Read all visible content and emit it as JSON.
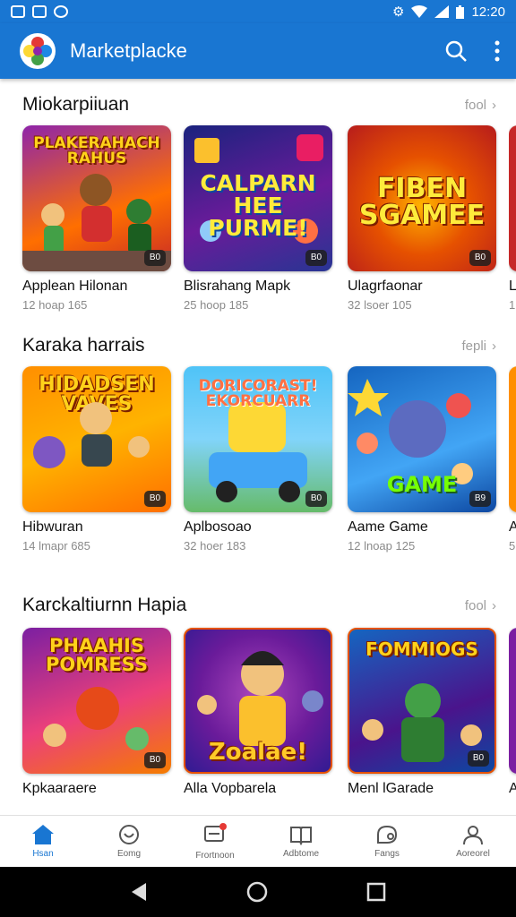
{
  "status_bar": {
    "time": "12:20"
  },
  "app_bar": {
    "title": "Marketplacke"
  },
  "sections": [
    {
      "title": "Miokarpiiuan",
      "more": "fool",
      "cards": [
        {
          "art": "PLAKERAHACH RAHUS",
          "title": "Applean Hilonan",
          "sub": "12 hoap 165",
          "badge": "B0"
        },
        {
          "art": "CALPARN HEE PURME!",
          "title": "Blisrahang Mapk",
          "sub": "25 hoop 185",
          "badge": "B0"
        },
        {
          "art": "FIBEN SGAMEE",
          "title": "Ulagrfaonar",
          "sub": "32 lsoer 105",
          "badge": "B0"
        },
        {
          "title": "L",
          "sub": "1"
        }
      ]
    },
    {
      "title": "Karaka harrais",
      "more": "fepli",
      "cards": [
        {
          "art": "HIDADSEN VAVES",
          "title": "Hibwuran",
          "sub": "14 lmapr 685",
          "badge": "B0"
        },
        {
          "art": "DORICORAST! EKORCUARR",
          "title": "Aplbosoao",
          "sub": "32 hoer 183",
          "badge": "B0"
        },
        {
          "art": "GAME",
          "title": "Aame Game",
          "sub": "12 lnoap 125",
          "badge": "B9"
        },
        {
          "title": "A",
          "sub": "5"
        }
      ]
    },
    {
      "title": "Karckaltiurnn Hapia",
      "more": "fool",
      "cards": [
        {
          "art": "PHAAHIS POMRESS",
          "title": "Kpkaaraere",
          "sub": "",
          "badge": "B0"
        },
        {
          "art": "Zoalae!",
          "title": "Alla Vopbarela",
          "sub": "",
          "badge": ""
        },
        {
          "art": "FOMMIOGS",
          "title": "Menl lGarade",
          "sub": "",
          "badge": "B0"
        },
        {
          "title": "A",
          "sub": ""
        }
      ]
    }
  ],
  "bottom_nav": [
    {
      "label": "Hsan",
      "icon": "home-icon",
      "active": true
    },
    {
      "label": "Eomg",
      "icon": "heart-icon"
    },
    {
      "label": "Frortnoon",
      "icon": "message-icon"
    },
    {
      "label": "Adbtome",
      "icon": "book-icon"
    },
    {
      "label": "Fangs",
      "icon": "tag-icon"
    },
    {
      "label": "Aoreorel",
      "icon": "person-icon"
    }
  ],
  "colors": {
    "primary": "#1976d2",
    "text": "#111111",
    "muted": "#8a8a8a"
  }
}
